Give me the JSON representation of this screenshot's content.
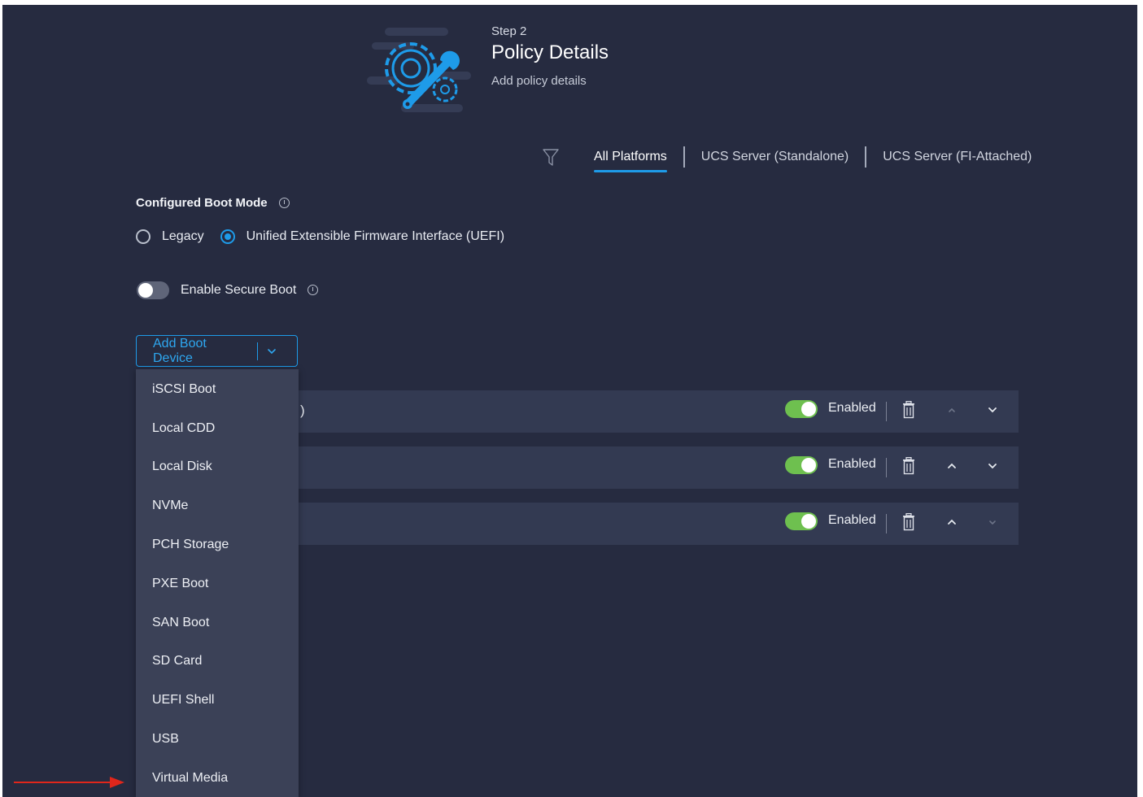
{
  "header": {
    "step": "Step 2",
    "title": "Policy Details",
    "subtitle": "Add policy details",
    "icon": "gear-wrench-icon"
  },
  "platform_tabs": {
    "filter_icon": "filter-icon",
    "tabs": [
      {
        "label": "All Platforms",
        "active": true
      },
      {
        "label": "UCS Server (Standalone)",
        "active": false
      },
      {
        "label": "UCS Server (FI-Attached)",
        "active": false
      }
    ]
  },
  "boot_mode": {
    "label": "Configured Boot Mode",
    "options": [
      {
        "label": "Legacy",
        "checked": false
      },
      {
        "label": "Unified Extensible Firmware Interface (UEFI)",
        "checked": true
      }
    ]
  },
  "secure_boot": {
    "label": "Enable Secure Boot",
    "enabled": false
  },
  "add_boot_device": {
    "label": "Add Boot Device"
  },
  "boot_devices": [
    {
      "partial_text": ")",
      "status": "Enabled"
    },
    {
      "partial_text": "",
      "status": "Enabled"
    },
    {
      "partial_text": "",
      "status": "Enabled"
    }
  ],
  "dropdown": {
    "items": [
      "iSCSI Boot",
      "Local CDD",
      "Local Disk",
      "NVMe",
      "PCH Storage",
      "PXE Boot",
      "SAN Boot",
      "SD Card",
      "UEFI Shell",
      "USB",
      "Virtual Media"
    ]
  },
  "colors": {
    "background": "#262b40",
    "accent": "#1e9be9",
    "enabled_toggle": "#6ec04f",
    "annotation_arrow": "#e0261b"
  }
}
